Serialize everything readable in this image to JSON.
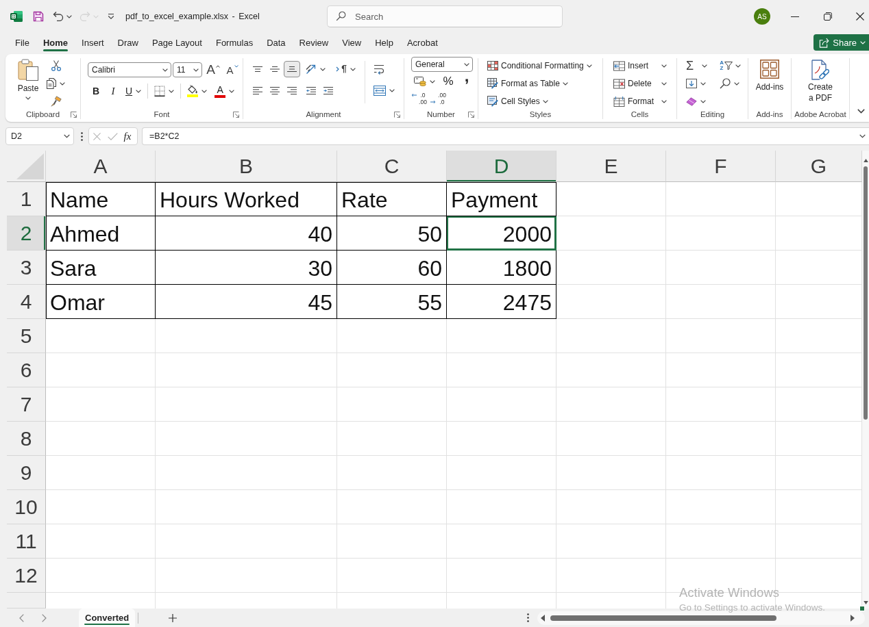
{
  "title_bar": {
    "quick_access": [
      {
        "kind": "save",
        "disabled": false
      },
      {
        "kind": "undo",
        "disabled": false,
        "menu": true
      },
      {
        "kind": "redo",
        "disabled": true,
        "menu": true
      },
      {
        "kind": "customize",
        "disabled": false
      }
    ],
    "title": "pdf_to_excel_example.xlsx - Excel",
    "search": {
      "placeholder": "Search"
    },
    "account": {
      "initials": "AS"
    }
  },
  "menu_tabs": [
    {
      "label": "File",
      "selected": false
    },
    {
      "label": "Home",
      "selected": true
    },
    {
      "label": "Insert",
      "selected": false
    },
    {
      "label": "Draw",
      "selected": false
    },
    {
      "label": "Page Layout",
      "selected": false
    },
    {
      "label": "Formulas",
      "selected": false
    },
    {
      "label": "Data",
      "selected": false
    },
    {
      "label": "Review",
      "selected": false
    },
    {
      "label": "View",
      "selected": false
    },
    {
      "label": "Help",
      "selected": false
    },
    {
      "label": "Acrobat",
      "selected": false
    }
  ],
  "share_button": {
    "label": "Share"
  },
  "ribbon": {
    "groups": [
      {
        "kind": "clipboard",
        "label": "Clipboard",
        "launcher": true,
        "paste_label": "Paste"
      },
      {
        "kind": "font",
        "label": "Font",
        "launcher": true,
        "font_name": "Calibri",
        "font_size": "11",
        "grow_label": "A",
        "shrink_label": "A",
        "bold_label": "B",
        "italic_label": "I",
        "underline_label": "U",
        "color_pickers": [
          {
            "kind": "fill-color",
            "color": "#ffff00"
          },
          {
            "kind": "font-color",
            "label": "A",
            "color": "#e00000"
          }
        ]
      },
      {
        "kind": "alignment",
        "label": "Alignment",
        "launcher": true,
        "vertical_align": [
          {
            "kind": "top",
            "selected": false
          },
          {
            "kind": "middle",
            "selected": false
          },
          {
            "kind": "bottom",
            "selected": true
          }
        ],
        "horizontal_align": [
          {
            "kind": "left",
            "selected": false
          },
          {
            "kind": "center",
            "selected": false
          },
          {
            "kind": "right",
            "selected": false
          }
        ]
      },
      {
        "kind": "number",
        "label": "Number",
        "launcher": true,
        "format": "General",
        "percent_label": "%",
        "comma_label": ",",
        "increase_decimal": [
          ".0",
          ".00"
        ],
        "decrease_decimal": [
          ".00",
          ".0"
        ]
      },
      {
        "kind": "styles",
        "label": "Styles",
        "buttons": [
          {
            "kind": "conditional-formatting",
            "label": "Conditional Formatting"
          },
          {
            "kind": "format-as-table",
            "label": "Format as Table"
          },
          {
            "kind": "cell-styles",
            "label": "Cell Styles"
          }
        ]
      },
      {
        "kind": "cells",
        "label": "Cells",
        "buttons": [
          {
            "kind": "insert",
            "label": "Insert"
          },
          {
            "kind": "delete",
            "label": "Delete"
          },
          {
            "kind": "format",
            "label": "Format"
          }
        ]
      },
      {
        "kind": "editing",
        "label": "Editing",
        "autosum_label": "Σ",
        "sort_labels": [
          "A",
          "Z"
        ]
      },
      {
        "kind": "add-ins",
        "label": "Add-ins",
        "button_label": "Add-ins"
      },
      {
        "kind": "acrobat",
        "label": "Adobe Acrobat",
        "button_label": "Create a PDF"
      }
    ]
  },
  "formula_bar": {
    "name_box": "D2",
    "function_label": "fx",
    "formula": "=B2*C2"
  },
  "sheet": {
    "columns": [
      {
        "label": "A",
        "selected": false
      },
      {
        "label": "B",
        "selected": false
      },
      {
        "label": "C",
        "selected": false
      },
      {
        "label": "D",
        "selected": true
      },
      {
        "label": "E",
        "selected": false
      },
      {
        "label": "F",
        "selected": false
      },
      {
        "label": "G",
        "selected": false
      }
    ],
    "rows": [
      {
        "label": "1",
        "selected": false,
        "cells": [
          {
            "value": "Name",
            "kind": "text",
            "selected": false
          },
          {
            "value": "Hours Worked",
            "kind": "text",
            "selected": false
          },
          {
            "value": "Rate",
            "kind": "text",
            "selected": false
          },
          {
            "value": "Payment",
            "kind": "text",
            "selected": false
          }
        ]
      },
      {
        "label": "2",
        "selected": true,
        "cells": [
          {
            "value": "Ahmed",
            "kind": "text",
            "selected": false
          },
          {
            "value": "40",
            "kind": "number",
            "selected": false
          },
          {
            "value": "50",
            "kind": "number",
            "selected": false
          },
          {
            "value": "2000",
            "kind": "number",
            "selected": true
          }
        ]
      },
      {
        "label": "3",
        "selected": false,
        "cells": [
          {
            "value": "Sara",
            "kind": "text",
            "selected": false
          },
          {
            "value": "30",
            "kind": "number",
            "selected": false
          },
          {
            "value": "60",
            "kind": "number",
            "selected": false
          },
          {
            "value": "1800",
            "kind": "number",
            "selected": false
          }
        ]
      },
      {
        "label": "4",
        "selected": false,
        "cells": [
          {
            "value": "Omar",
            "kind": "text",
            "selected": false
          },
          {
            "value": "45",
            "kind": "number",
            "selected": false
          },
          {
            "value": "55",
            "kind": "number",
            "selected": false
          },
          {
            "value": "2475",
            "kind": "number",
            "selected": false
          }
        ]
      },
      {
        "label": "5",
        "selected": false
      },
      {
        "label": "6",
        "selected": false
      },
      {
        "label": "7",
        "selected": false
      },
      {
        "label": "8",
        "selected": false
      },
      {
        "label": "9",
        "selected": false
      },
      {
        "label": "10",
        "selected": false
      },
      {
        "label": "11",
        "selected": false
      },
      {
        "label": "12",
        "selected": false
      }
    ]
  },
  "sheet_tabs": [
    {
      "label": "Converted",
      "selected": true
    }
  ],
  "activation_notice": {
    "title": "Activate Windows",
    "message": "Go to Settings to activate Windows."
  }
}
